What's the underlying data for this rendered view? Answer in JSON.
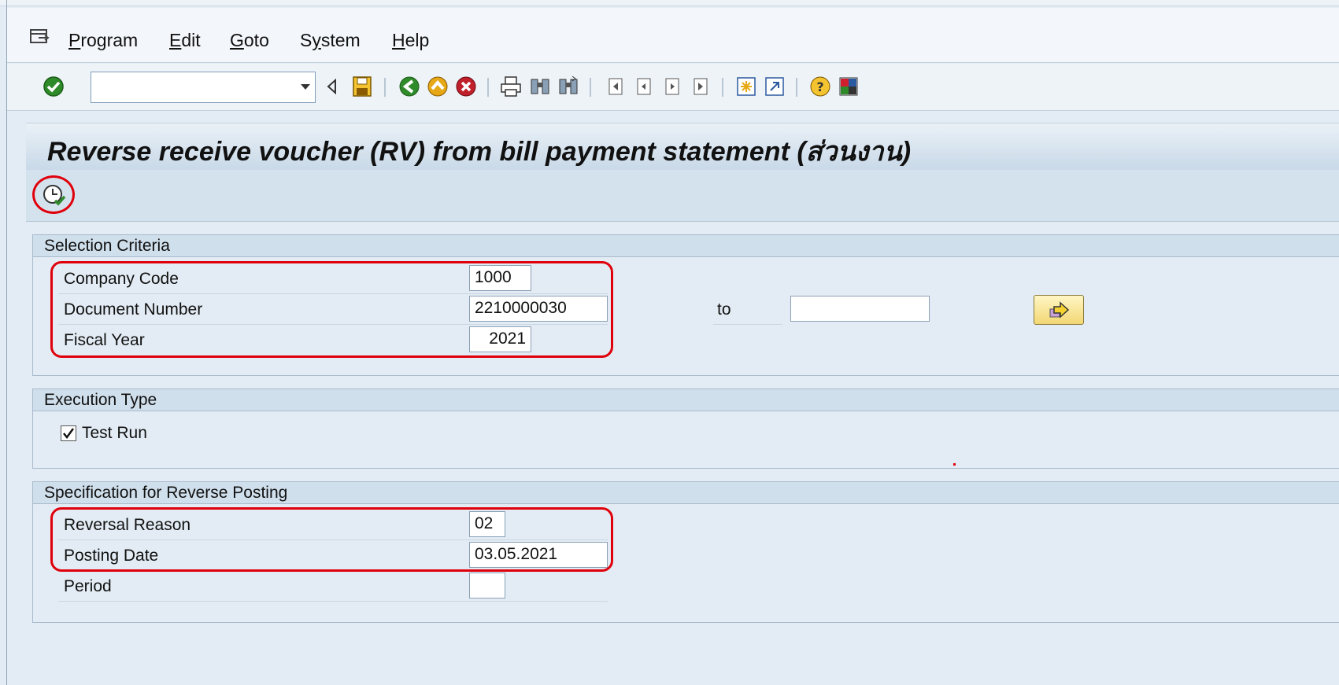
{
  "menu": {
    "items": [
      {
        "label": "Program",
        "underline": "P",
        "rest": "rogram"
      },
      {
        "label": "Edit",
        "underline": "E",
        "rest": "dit"
      },
      {
        "label": "Goto",
        "underline": "G",
        "rest": "oto"
      },
      {
        "label": "System",
        "pre": "S",
        "underline": "y",
        "rest": "stem"
      },
      {
        "label": "Help",
        "underline": "H",
        "rest": "elp"
      }
    ]
  },
  "toolbar": {
    "command_field_value": "",
    "icons": [
      "enter-icon",
      "back-triangle-icon",
      "save-icon",
      "back-icon",
      "exit-icon",
      "cancel-icon",
      "print-icon",
      "find-icon",
      "find-next-icon",
      "first-page-icon",
      "previous-page-icon",
      "next-page-icon",
      "last-page-icon",
      "create-session-icon",
      "shortcut-icon",
      "help-icon",
      "customize-layout-icon"
    ]
  },
  "title": "Reverse receive voucher (RV) from bill payment statement (ส่วนงาน)",
  "app_toolbar": {
    "execute_icon": "execute-clock-icon"
  },
  "selection_criteria": {
    "header": "Selection Criteria",
    "company_code_label": "Company Code",
    "company_code_value": "1000",
    "document_number_label": "Document Number",
    "document_number_from": "2210000030",
    "to_label": "to",
    "document_number_to": "",
    "multiple_selection_icon": "multiple-selection-arrow-icon",
    "fiscal_year_label": "Fiscal Year",
    "fiscal_year_value": "2021"
  },
  "execution_type": {
    "header": "Execution Type",
    "test_run_label": "Test Run",
    "test_run_checked": true
  },
  "reverse_posting": {
    "header": "Specification for Reverse Posting",
    "reversal_reason_label": "Reversal Reason",
    "reversal_reason_value": "02",
    "posting_date_label": "Posting Date",
    "posting_date_value": "03.05.2021",
    "period_label": "Period",
    "period_value": ""
  },
  "colors": {
    "highlight": "#e0000b",
    "header_bg": "#d0dfec",
    "body_bg": "#e3ecf4"
  }
}
